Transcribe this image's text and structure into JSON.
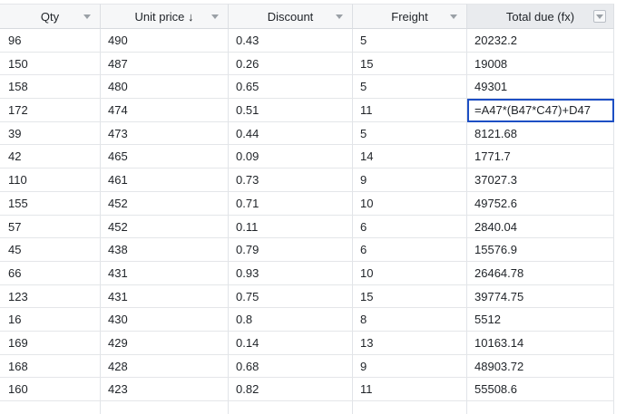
{
  "columns": [
    {
      "label": "Qty"
    },
    {
      "label": "Unit price ↓"
    },
    {
      "label": "Discount"
    },
    {
      "label": "Freight"
    },
    {
      "label": "Total due (fx)"
    }
  ],
  "active_column": 4,
  "editing_cell": {
    "row": 3,
    "col": 4
  },
  "rows": [
    [
      "96",
      "490",
      "0.43",
      "5",
      "20232.2"
    ],
    [
      "150",
      "487",
      "0.26",
      "15",
      "19008"
    ],
    [
      "158",
      "480",
      "0.65",
      "5",
      "49301"
    ],
    [
      "172",
      "474",
      "0.51",
      "11",
      "=A47*(B47*C47)+D47"
    ],
    [
      "39",
      "473",
      "0.44",
      "5",
      "8121.68"
    ],
    [
      "42",
      "465",
      "0.09",
      "14",
      "1771.7"
    ],
    [
      "110",
      "461",
      "0.73",
      "9",
      "37027.3"
    ],
    [
      "155",
      "452",
      "0.71",
      "10",
      "49752.6"
    ],
    [
      "57",
      "452",
      "0.11",
      "6",
      "2840.04"
    ],
    [
      "45",
      "438",
      "0.79",
      "6",
      "15576.9"
    ],
    [
      "66",
      "431",
      "0.93",
      "10",
      "26464.78"
    ],
    [
      "123",
      "431",
      "0.75",
      "15",
      "39774.75"
    ],
    [
      "16",
      "430",
      "0.8",
      "8",
      "5512"
    ],
    [
      "169",
      "429",
      "0.14",
      "13",
      "10163.14"
    ],
    [
      "168",
      "428",
      "0.68",
      "9",
      "48903.72"
    ],
    [
      "160",
      "423",
      "0.82",
      "11",
      "55508.6"
    ],
    [
      "",
      "",
      "",
      "",
      ""
    ]
  ]
}
